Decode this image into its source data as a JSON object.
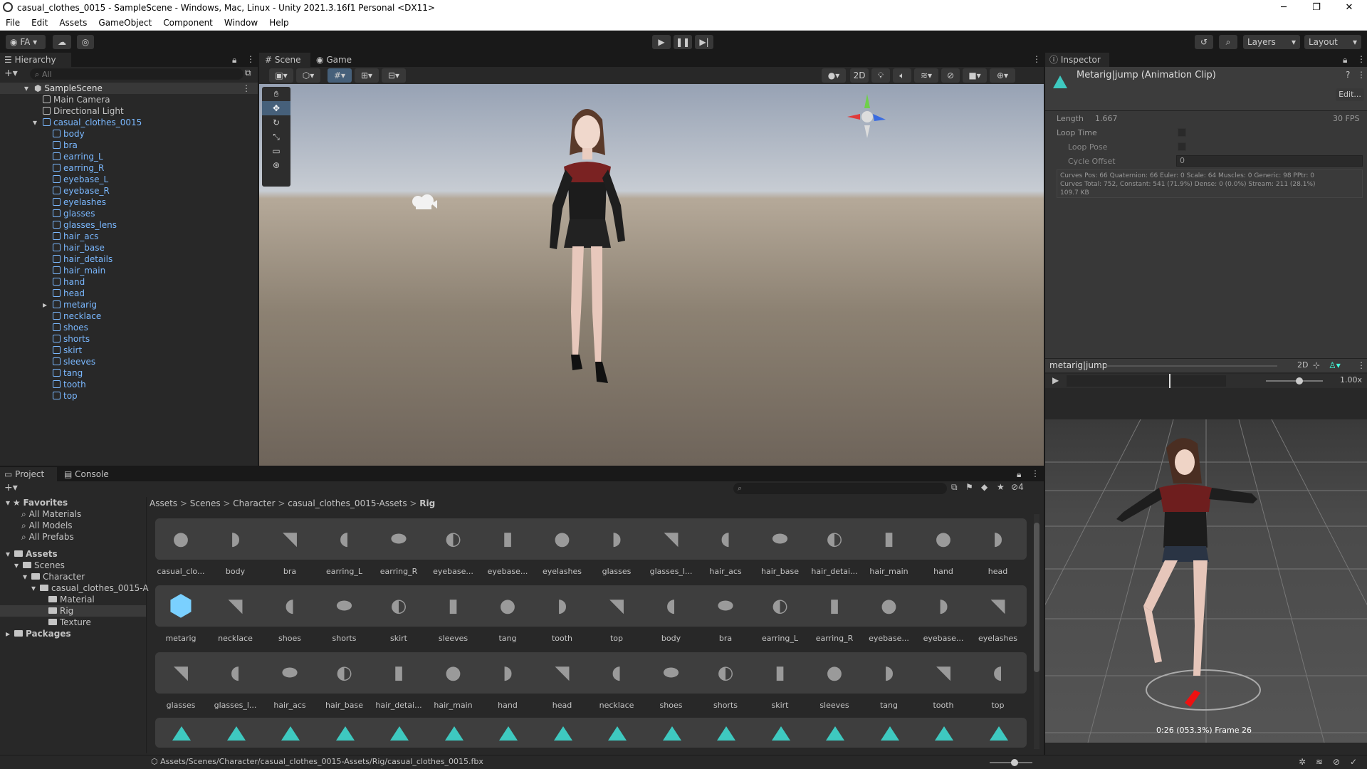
{
  "window": {
    "title": "casual_clothes_0015 - SampleScene - Windows, Mac, Linux - Unity 2021.3.16f1 Personal <DX11>"
  },
  "menu": [
    "File",
    "Edit",
    "Assets",
    "GameObject",
    "Component",
    "Window",
    "Help"
  ],
  "toolbar": {
    "account": "FA",
    "layers": "Layers",
    "layout": "Layout"
  },
  "hierarchy": {
    "tab": "Hierarchy",
    "search_placeholder": "All",
    "scene": "SampleScene",
    "items": [
      {
        "name": "Main Camera",
        "level": 1,
        "blue": false
      },
      {
        "name": "Directional Light",
        "level": 1,
        "blue": false
      },
      {
        "name": "casual_clothes_0015",
        "level": 1,
        "blue": true,
        "expanded": true
      },
      {
        "name": "body",
        "level": 2,
        "blue": true
      },
      {
        "name": "bra",
        "level": 2,
        "blue": true
      },
      {
        "name": "earring_L",
        "level": 2,
        "blue": true
      },
      {
        "name": "earring_R",
        "level": 2,
        "blue": true
      },
      {
        "name": "eyebase_L",
        "level": 2,
        "blue": true
      },
      {
        "name": "eyebase_R",
        "level": 2,
        "blue": true
      },
      {
        "name": "eyelashes",
        "level": 2,
        "blue": true
      },
      {
        "name": "glasses",
        "level": 2,
        "blue": true
      },
      {
        "name": "glasses_lens",
        "level": 2,
        "blue": true
      },
      {
        "name": "hair_acs",
        "level": 2,
        "blue": true
      },
      {
        "name": "hair_base",
        "level": 2,
        "blue": true
      },
      {
        "name": "hair_details",
        "level": 2,
        "blue": true
      },
      {
        "name": "hair_main",
        "level": 2,
        "blue": true
      },
      {
        "name": "hand",
        "level": 2,
        "blue": true
      },
      {
        "name": "head",
        "level": 2,
        "blue": true
      },
      {
        "name": "metarig",
        "level": 2,
        "blue": true,
        "collapsed": true
      },
      {
        "name": "necklace",
        "level": 2,
        "blue": true
      },
      {
        "name": "shoes",
        "level": 2,
        "blue": true
      },
      {
        "name": "shorts",
        "level": 2,
        "blue": true
      },
      {
        "name": "skirt",
        "level": 2,
        "blue": true
      },
      {
        "name": "sleeves",
        "level": 2,
        "blue": true
      },
      {
        "name": "tang",
        "level": 2,
        "blue": true
      },
      {
        "name": "tooth",
        "level": 2,
        "blue": true
      },
      {
        "name": "top",
        "level": 2,
        "blue": true
      }
    ]
  },
  "scene_view": {
    "tabs": [
      "Scene",
      "Game"
    ],
    "mode_2d": "2D"
  },
  "inspector": {
    "tab": "Inspector",
    "title": "Metarig|jump (Animation Clip)",
    "edit": "Edit...",
    "length_label": "Length",
    "length_value": "1.667",
    "fps": "30 FPS",
    "loop_time": "Loop Time",
    "loop_pose": "Loop Pose",
    "cycle_offset": "Cycle Offset",
    "cycle_offset_value": "0",
    "stats_1": "Curves Pos: 66 Quaternion: 66 Euler: 0 Scale: 64 Muscles: 0 Generic: 98 PPtr: 0",
    "stats_2": "Curves Total: 752, Constant: 541 (71.9%) Dense: 0 (0.0%) Stream: 211 (28.1%)",
    "stats_3": "109.7 KB"
  },
  "anim_preview": {
    "clip": "metarig|jump",
    "mode_2d": "2D",
    "speed": "1.00x",
    "frame_text": "0:26 (053.3%) Frame 26"
  },
  "project": {
    "tabs": [
      "Project",
      "Console"
    ],
    "badge": "4",
    "favorites": {
      "label": "Favorites",
      "items": [
        "All Materials",
        "All Models",
        "All Prefabs"
      ]
    },
    "tree": [
      {
        "name": "Assets",
        "level": 0
      },
      {
        "name": "Scenes",
        "level": 1
      },
      {
        "name": "Character",
        "level": 2
      },
      {
        "name": "casual_clothes_0015-A",
        "level": 3
      },
      {
        "name": "Material",
        "level": 4
      },
      {
        "name": "Rig",
        "level": 4,
        "selected": true
      },
      {
        "name": "Texture",
        "level": 4
      },
      {
        "name": "Packages",
        "level": 0
      }
    ],
    "breadcrumb": [
      "Assets",
      "Scenes",
      "Character",
      "casual_clothes_0015-Assets",
      "Rig"
    ],
    "row1": [
      "casual_clo...",
      "body",
      "bra",
      "earring_L",
      "earring_R",
      "eyebase...",
      "eyebase...",
      "eyelashes",
      "glasses",
      "glasses_l...",
      "hair_acs",
      "hair_base",
      "hair_detai...",
      "hair_main",
      "hand",
      "head"
    ],
    "row2": [
      "metarig",
      "necklace",
      "shoes",
      "shorts",
      "skirt",
      "sleeves",
      "tang",
      "tooth",
      "top",
      "body",
      "bra",
      "earring_L",
      "earring_R",
      "eyebase...",
      "eyebase...",
      "eyelashes"
    ],
    "row3": [
      "glasses",
      "glasses_l...",
      "hair_acs",
      "hair_base",
      "hair_detai...",
      "hair_main",
      "hand",
      "head",
      "necklace",
      "shoes",
      "shorts",
      "skirt",
      "sleeves",
      "tang",
      "tooth",
      "top"
    ],
    "status_path": "Assets/Scenes/Character/casual_clothes_0015-Assets/Rig/casual_clothes_0015.fbx"
  },
  "colors": {
    "accent": "#2c5d87",
    "selected": "#2c5d87",
    "link": "#7ab8ff",
    "panel": "#282828",
    "inspector": "#383838"
  }
}
